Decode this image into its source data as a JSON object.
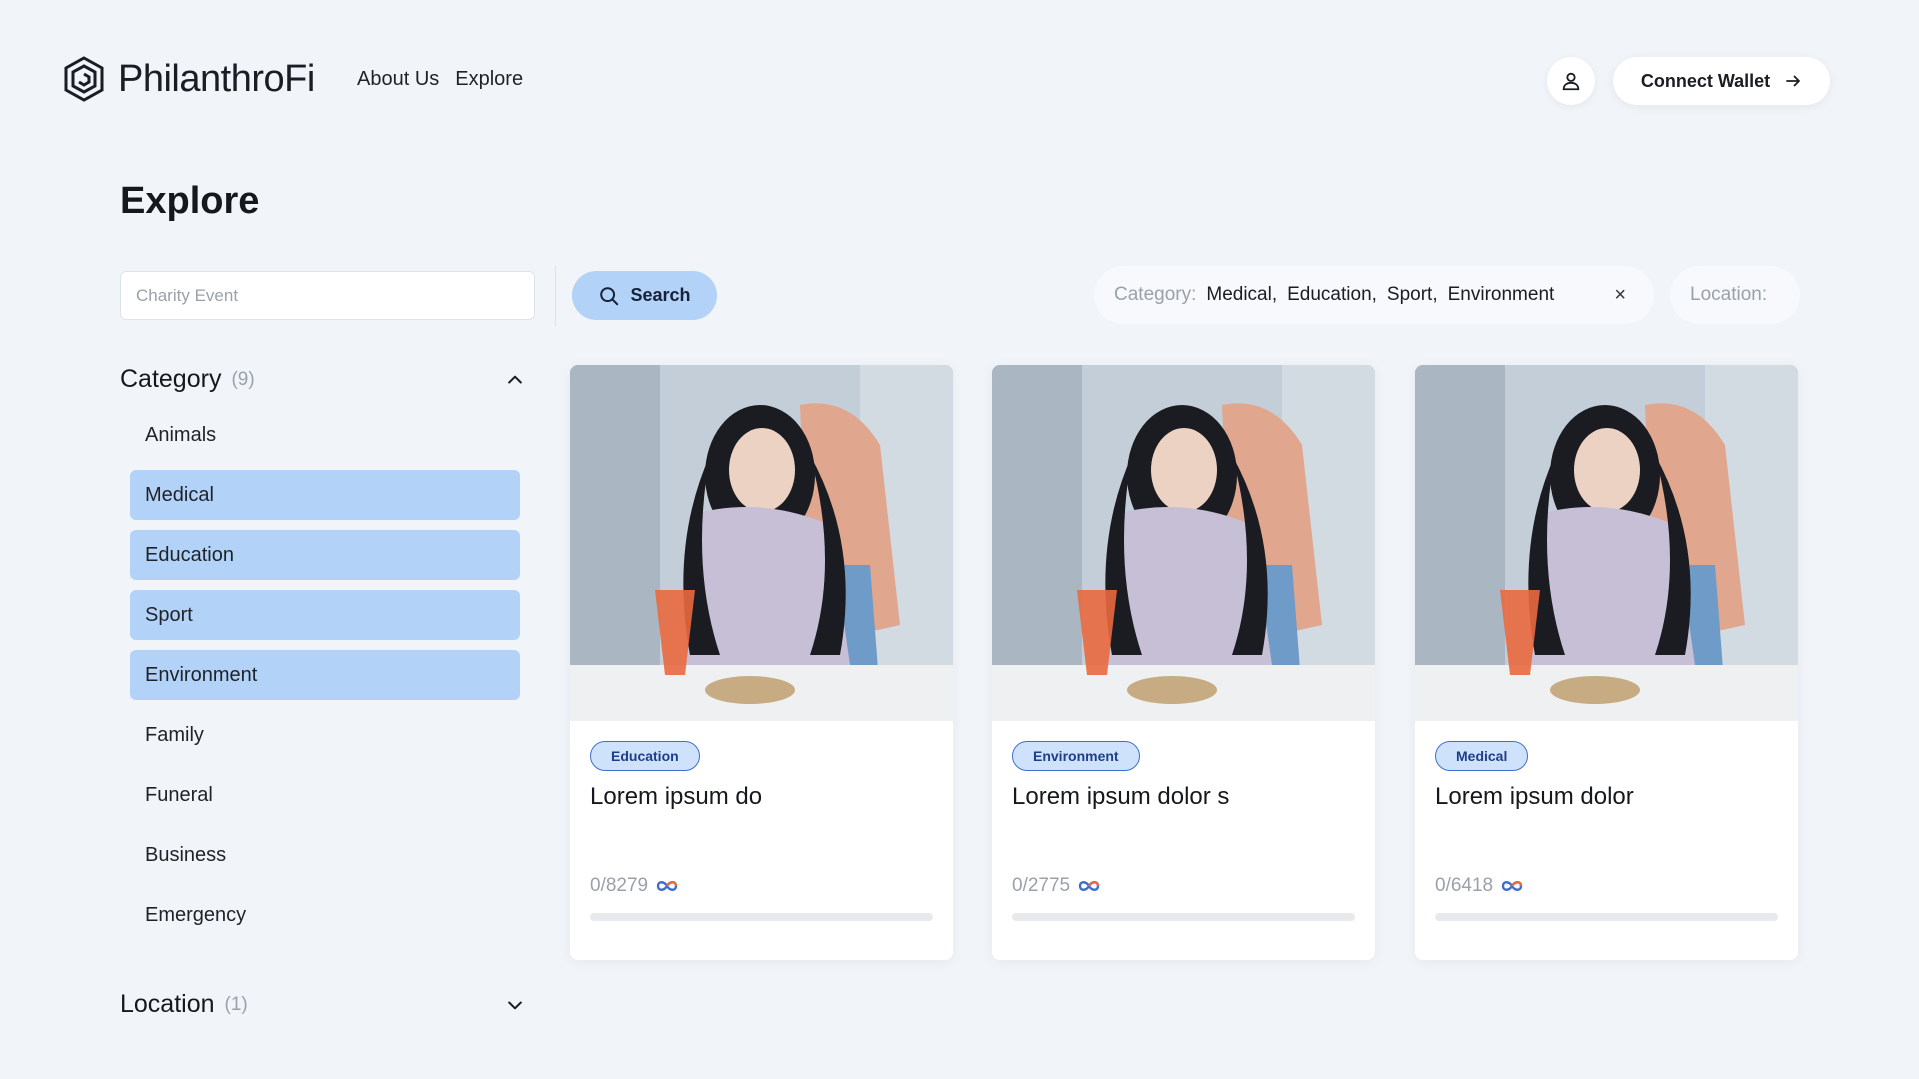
{
  "header": {
    "brand": "PhilanthroFi",
    "nav": [
      "About Us",
      "Explore"
    ],
    "wallet_label": "Connect Wallet"
  },
  "page_title": "Explore",
  "search": {
    "placeholder": "Charity Event",
    "button_label": "Search"
  },
  "filters": {
    "category_label": "Category:",
    "category_values": [
      "Medical,",
      "Education,",
      "Sport,",
      "Environment"
    ],
    "clear_symbol": "×",
    "location_label": "Location:"
  },
  "sidebar": {
    "category": {
      "title": "Category",
      "count": "(9)",
      "items": [
        {
          "label": "Animals",
          "selected": false
        },
        {
          "label": "Medical",
          "selected": true
        },
        {
          "label": "Education",
          "selected": true
        },
        {
          "label": "Sport",
          "selected": true
        },
        {
          "label": "Environment",
          "selected": true
        },
        {
          "label": "Family",
          "selected": false
        },
        {
          "label": "Funeral",
          "selected": false
        },
        {
          "label": "Business",
          "selected": false
        },
        {
          "label": "Emergency",
          "selected": false
        }
      ]
    },
    "location": {
      "title": "Location",
      "count": "(1)"
    }
  },
  "cards": [
    {
      "badge": "Education",
      "title": "Lorem ipsum do",
      "progress": "0/8279",
      "progress_fraction": 0
    },
    {
      "badge": "Environment",
      "title": "Lorem ipsum dolor s",
      "progress": "0/2775",
      "progress_fraction": 0
    },
    {
      "badge": "Medical",
      "title": "Lorem ipsum dolor",
      "progress": "0/6418",
      "progress_fraction": 0
    }
  ],
  "colors": {
    "background": "#f1f4f8",
    "accent_light": "#b3d2f7",
    "badge_border": "#3d6fd1",
    "text_muted": "#9aa1ab"
  }
}
